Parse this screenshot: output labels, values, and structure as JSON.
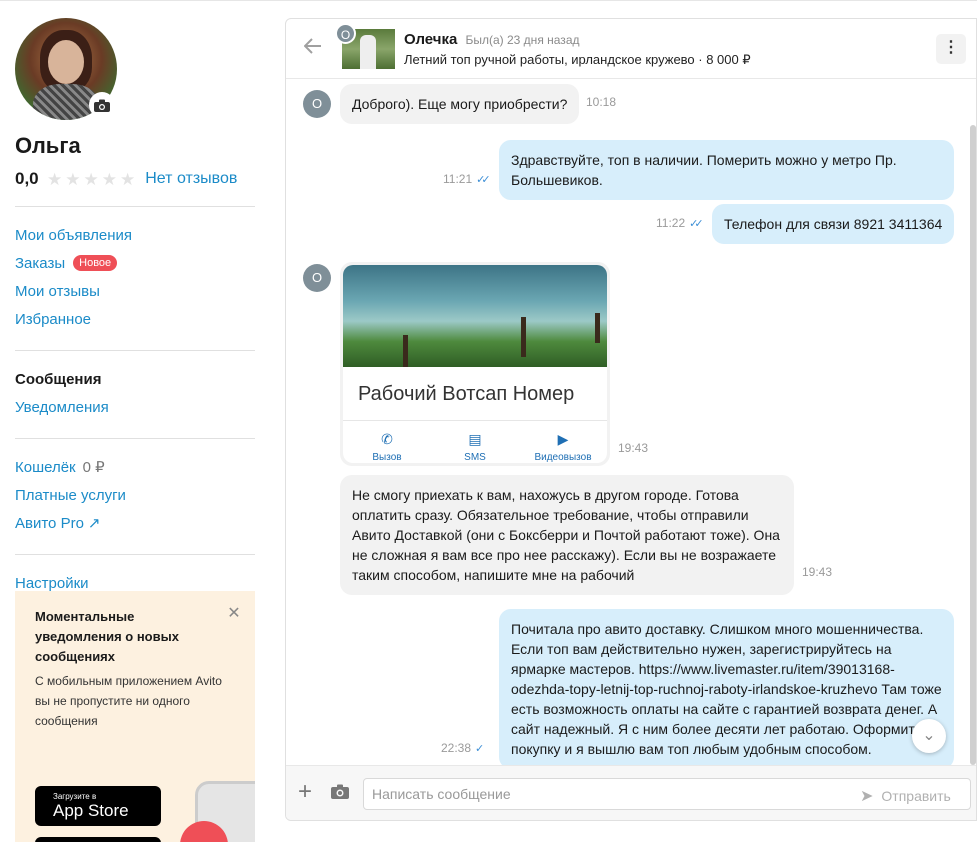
{
  "profile": {
    "name": "Ольга",
    "rating": "0,0",
    "reviews_link": "Нет отзывов"
  },
  "menu": {
    "my_ads": "Мои объявления",
    "orders": "Заказы",
    "orders_badge": "Новое",
    "my_reviews": "Мои отзывы",
    "favorites": "Избранное",
    "messages": "Сообщения",
    "notifications": "Уведомления",
    "wallet": "Кошелёк",
    "wallet_amount": "0 ₽",
    "paid_services": "Платные услуги",
    "avito_pro": "Авито Pro",
    "settings": "Настройки"
  },
  "promo": {
    "title": "Моментальные уведомления о новых сообщениях",
    "text": "С мобильным приложением Avito вы не пропустите ни одного сообщения",
    "appstore_small": "Загрузите в",
    "appstore_big": "App Store"
  },
  "chat": {
    "contact_initial": "О",
    "contact_name": "Олечка",
    "contact_status": "Был(а) 23 дня назад",
    "ad_title": "Летний топ ручной работы, ирландское кружево · 8 000 ₽",
    "messages": [
      {
        "dir": "in",
        "text": "Доброго). Еще могу приобрести?",
        "time": "10:18"
      },
      {
        "dir": "out",
        "text": "Здравствуйте, топ в наличии. Померить можно у метро Пр. Большевиков.",
        "time": "11:21"
      },
      {
        "dir": "out",
        "text": "Телефон для связи 8921 3411364",
        "time": "11:22"
      },
      {
        "dir": "in",
        "card_title": "Рабочий Вотсап Номер",
        "actions": [
          "Вызов",
          "SMS",
          "Видеовызов"
        ],
        "time": "19:43"
      },
      {
        "dir": "in",
        "text": "Не смогу приехать к вам, нахожусь в другом городе. Готова оплатить сразу. Обязательное требование, чтобы отправили Авито Доставкой (они с Боксберри и Почтой работают тоже). Она не сложная я вам все про нее расскажу). Если вы не возражаете таким способом, напишите мне на рабочий",
        "time": "19:43"
      },
      {
        "dir": "out",
        "text": "Почитала про авито доставку. Слишком много мошенничества. Если топ вам действительно нужен, зарегистрируйтесь на ярмарке мастеров. https://www.livemaster.ru/item/39013168-odezhda-topy-letnij-top-ruchnoj-raboty-irlandskoe-kruzhevo Там тоже есть возможность оплаты на сайте с гарантией возврата денег. А сайт надежный. Я с ним более десяти лет работаю. Оформите покупку и я вышлю вам топ любым удобным способом.",
        "time": "22:38"
      }
    ],
    "input_placeholder": "Написать сообщение",
    "send_label": "Отправить"
  },
  "icons": {
    "back": "arrow-left-icon",
    "camera": "camera-icon",
    "more": "kebab-icon",
    "close": "close-icon",
    "send": "send-icon",
    "attach": "plus-icon",
    "scroll_down": "chevron-down-icon",
    "read_receipt": "double-check-icon"
  },
  "colors": {
    "link": "#1b8bc8",
    "badge": "#ef4f57",
    "out_bubble": "#d7eefb",
    "in_bubble": "#f2f2f2",
    "promo_bg": "#fdf1e0"
  }
}
